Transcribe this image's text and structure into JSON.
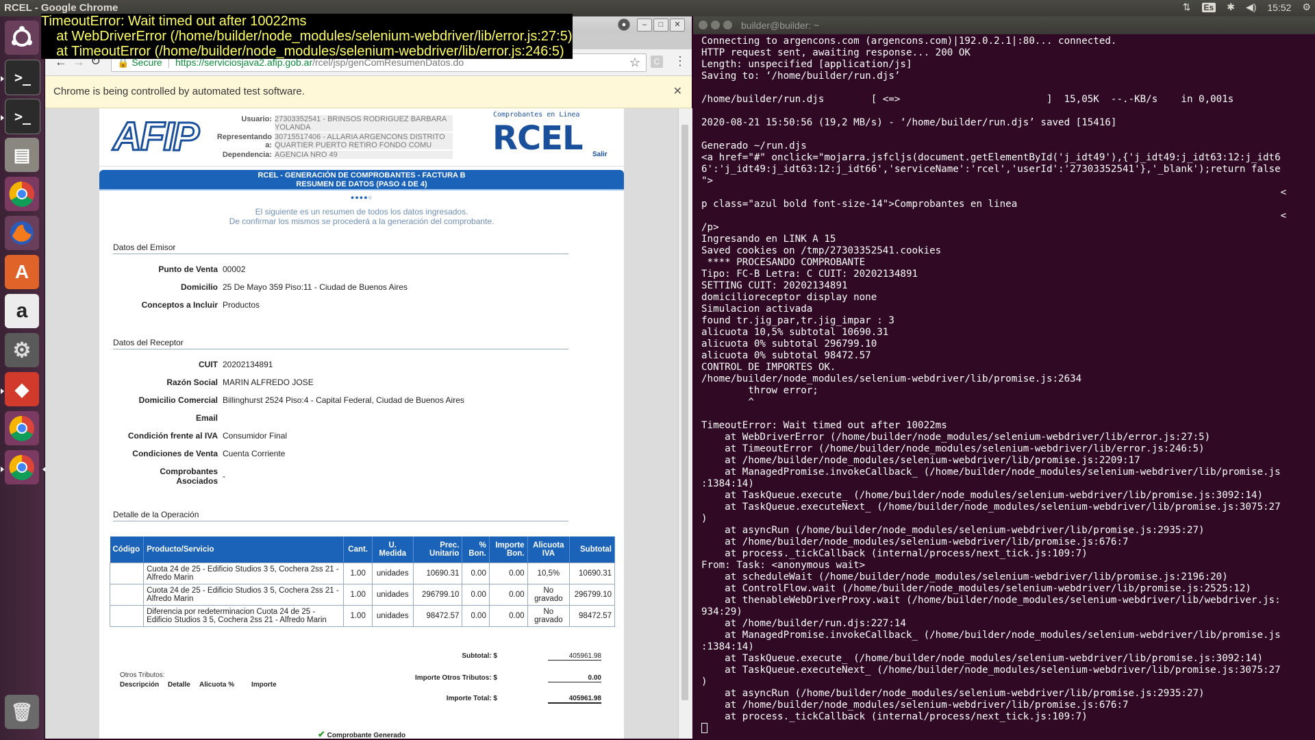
{
  "window": {
    "title": "RCEL - Google Chrome"
  },
  "panel": {
    "keyboard": "Es",
    "clock": "15:52"
  },
  "launcher": {
    "items": [
      "ubuntu-dash",
      "terminal",
      "terminal-2",
      "files",
      "chrome",
      "firefox",
      "software-center",
      "amazon",
      "system-settings",
      "anydesk",
      "chrome-2",
      "chrome-3",
      "trash"
    ]
  },
  "browser": {
    "secure_label": "Secure",
    "url_host": "https://serviciosjava2.afip.gob.ar",
    "url_path": "/rcel/jsp/genComResumenDatos.do",
    "infobar_text": "Chrome is being controlled by automated test software."
  },
  "afip": {
    "usuario_label": "Usuario:",
    "usuario_value": "27303352541 - BRINSOS RODRIGUEZ BARBARA YOLANDA",
    "representando_label": "Representando a:",
    "representando_value": "30715517406 - ALLARIA ARGENCONS DISTRITO QUARTIER PUERTO RETIRO FONDO COMU",
    "dependencia_label": "Dependencia:",
    "dependencia_value": "AGENCIA NRO 49",
    "rcel_caption": "Comprobantes en Linea",
    "rcel_logo": "RCEL",
    "afip_logo": "AFIP",
    "salir": "Salir",
    "banner_line1": "RCEL - GENERACIÓN DE COMPROBANTES - FACTURA B",
    "banner_line2": "RESUMEN DE DATOS (PASO 4 DE 4)",
    "intro_line1": "El siguiente es un resumen de todos los datos ingresados.",
    "intro_line2": "De confirmar los mismos se procederá a la generación del comprobante.",
    "emisor_title": "Datos del Emisor",
    "emisor": [
      {
        "label": "Punto de Venta",
        "value": "00002"
      },
      {
        "label": "Domicilio",
        "value": "25 De Mayo 359 Piso:11 - Ciudad de Buenos Aires"
      },
      {
        "label": "Conceptos a Incluir",
        "value": "Productos"
      }
    ],
    "receptor_title": "Datos del Receptor",
    "receptor": [
      {
        "label": "CUIT",
        "value": "20202134891"
      },
      {
        "label": "Razón Social",
        "value": "MARIN ALFREDO JOSE"
      },
      {
        "label": "Domicilio Comercial",
        "value": "Billinghurst 2524 Piso:4 - Capital Federal, Ciudad de Buenos Aires"
      },
      {
        "label": "Email",
        "value": ""
      },
      {
        "label": "Condición frente al IVA",
        "value": "Consumidor Final"
      },
      {
        "label": "Condiciones de Venta",
        "value": "Cuenta Corriente"
      },
      {
        "label": "Comprobantes Asociados",
        "value": "-"
      }
    ],
    "detalle_title": "Detalle de la Operación",
    "table_headers": [
      "Código",
      "Producto/Servicio",
      "Cant.",
      "U. Medida",
      "Prec. Unitario",
      "% Bon.",
      "Importe Bon.",
      "Alicuota IVA",
      "Subtotal"
    ],
    "table_rows": [
      [
        "",
        "Cuota 24 de 25 - Edificio Studios 3 5, Cochera 2ss 21 - Alfredo Marin",
        "1.00",
        "unidades",
        "10690.31",
        "0.00",
        "0.00",
        "10,5%",
        "10690.31"
      ],
      [
        "",
        "Cuota 24 de 25 - Edificio Studios 3 5, Cochera 2ss 21 - Alfredo Marin",
        "1.00",
        "unidades",
        "296799.10",
        "0.00",
        "0.00",
        "No gravado",
        "296799.10"
      ],
      [
        "",
        "Diferencia por redeterminacion Cuota 24 de 25 - Edificio Studios 3 5, Cochera 2ss 21 - Alfredo Marin",
        "1.00",
        "unidades",
        "98472.57",
        "0.00",
        "0.00",
        "No gravado",
        "98472.57"
      ]
    ],
    "otros_tributos_label": "Otros Tributos:",
    "otros_headers": [
      "Descripción",
      "Detalle",
      "Alicuota %",
      "Importe"
    ],
    "subtotal_label": "Subtotal: $",
    "subtotal_value": "405961.98",
    "otros_label": "Importe Otros Tributos: $",
    "otros_value": "0.00",
    "total_label": "Importe Total: $",
    "total_value": "405961.98",
    "generado": "Comprobante Generado"
  },
  "terminal": {
    "title": "builder@builder: ~",
    "lines": [
      "Connecting to argencons.com (argencons.com)|192.0.2.1|:80... connected.",
      "HTTP request sent, awaiting response... 200 OK",
      "Length: unspecified [application/js]",
      "Saving to: ‘/home/builder/run.djs’",
      "",
      "/home/builder/run.djs        [ <=>                         ]  15,05K  --.-KB/s    in 0,001s",
      "",
      "2020-08-21 15:50:56 (19,2 MB/s) - ‘/home/builder/run.djs’ saved [15416]",
      "",
      "Generado ~/run.djs",
      "<a href=\"#\" onclick=\"mojarra.jsfcljs(document.getElementById('j_idt49'),{'j_idt49:j_idt63:12:j_idt6",
      "6':'j_idt49:j_idt63:12:j_idt66','serviceName':'rcel','userId':'27303352541'},'_blank');return false",
      "\">",
      "                                                                                                   <",
      "p class=\"azul bold font-size-14\">Comprobantes en linea",
      "                                                                                                   <",
      "/p>",
      "Ingresando en LINK A 15",
      "Saved cookies on /tmp/27303352541.cookies",
      " **** PROCESANDO COMPROBANTE",
      "Tipo: FC-B Letra: C CUIT: 20202134891",
      "SETTING CUIT: 20202134891",
      "domicilioreceptor display none",
      "Simulacion activada",
      "found tr.jig_par,tr.jig_impar : 3",
      "alicuota 10,5% subtotal 10690.31",
      "alicuota 0% subtotal 296799.10",
      "alicuota 0% subtotal 98472.57",
      "CONTROL DE IMPORTES OK.",
      "/home/builder/node_modules/selenium-webdriver/lib/promise.js:2634",
      "        throw error;",
      "        ^",
      "",
      "TimeoutError: Wait timed out after 10022ms",
      "    at WebDriverError (/home/builder/node_modules/selenium-webdriver/lib/error.js:27:5)",
      "    at TimeoutError (/home/builder/node_modules/selenium-webdriver/lib/error.js:246:5)",
      "    at /home/builder/node_modules/selenium-webdriver/lib/promise.js:2209:17",
      "    at ManagedPromise.invokeCallback_ (/home/builder/node_modules/selenium-webdriver/lib/promise.js",
      ":1384:14)",
      "    at TaskQueue.execute_ (/home/builder/node_modules/selenium-webdriver/lib/promise.js:3092:14)",
      "    at TaskQueue.executeNext_ (/home/builder/node_modules/selenium-webdriver/lib/promise.js:3075:27",
      ")",
      "    at asyncRun (/home/builder/node_modules/selenium-webdriver/lib/promise.js:2935:27)",
      "    at /home/builder/node_modules/selenium-webdriver/lib/promise.js:676:7",
      "    at process._tickCallback (internal/process/next_tick.js:109:7)",
      "From: Task: <anonymous wait>",
      "    at scheduleWait (/home/builder/node_modules/selenium-webdriver/lib/promise.js:2196:20)",
      "    at ControlFlow.wait (/home/builder/node_modules/selenium-webdriver/lib/promise.js:2525:12)",
      "    at thenableWebDriverProxy.wait (/home/builder/node_modules/selenium-webdriver/lib/webdriver.js:",
      "934:29)",
      "    at /home/builder/run.djs:227:14",
      "    at ManagedPromise.invokeCallback_ (/home/builder/node_modules/selenium-webdriver/lib/promise.js",
      ":1384:14)",
      "    at TaskQueue.execute_ (/home/builder/node_modules/selenium-webdriver/lib/promise.js:3092:14)",
      "    at TaskQueue.executeNext_ (/home/builder/node_modules/selenium-webdriver/lib/promise.js:3075:27",
      ")",
      "    at asyncRun (/home/builder/node_modules/selenium-webdriver/lib/promise.js:2935:27)",
      "    at /home/builder/node_modules/selenium-webdriver/lib/promise.js:676:7",
      "    at process._tickCallback (internal/process/next_tick.js:109:7)"
    ]
  },
  "error_overlay": {
    "lines": [
      "TimeoutError: Wait timed out after 10022ms",
      "    at WebDriverError (/home/builder/node_modules/selenium-webdriver/lib/error.js:27:5)",
      "    at TimeoutError (/home/builder/node_modules/selenium-webdriver/lib/error.js:246:5)"
    ]
  }
}
